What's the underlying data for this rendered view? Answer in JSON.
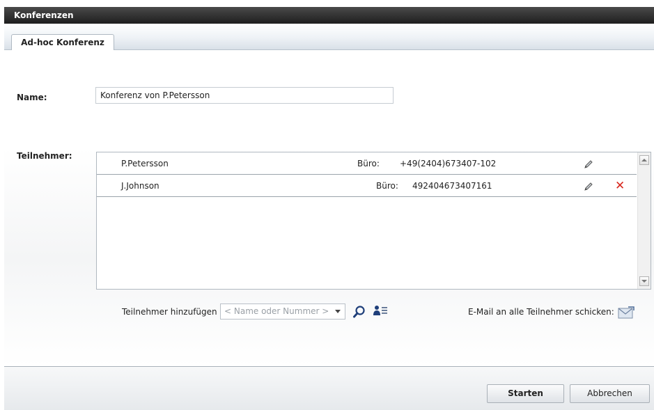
{
  "window": {
    "title": "Konferenzen"
  },
  "tabs": [
    {
      "label": "Ad-hoc Konferenz",
      "active": true
    }
  ],
  "form": {
    "name_label": "Name:",
    "name_value": "Konferenz von P.Petersson",
    "participants_label": "Teilnehmer:"
  },
  "participants": [
    {
      "name": "P.Petersson",
      "type": "Büro:",
      "number": "+49(2404)673407-102",
      "deletable": false
    },
    {
      "name": "J.Johnson",
      "type": "Büro:",
      "number": "492404673407161",
      "deletable": true
    }
  ],
  "add": {
    "label": "Teilnehmer hinzufügen",
    "placeholder": "< Name oder Nummer >"
  },
  "email": {
    "label": "E-Mail an alle Teilnehmer schicken:"
  },
  "buttons": {
    "start": "Starten",
    "cancel": "Abbrechen"
  },
  "icons": {
    "edit": "pencil-icon",
    "delete": "close-icon",
    "search": "search-icon",
    "directory": "contact-list-icon",
    "email": "envelope-icon"
  },
  "colors": {
    "titlebar": "#2b2b2b",
    "delete": "#d8281e"
  }
}
